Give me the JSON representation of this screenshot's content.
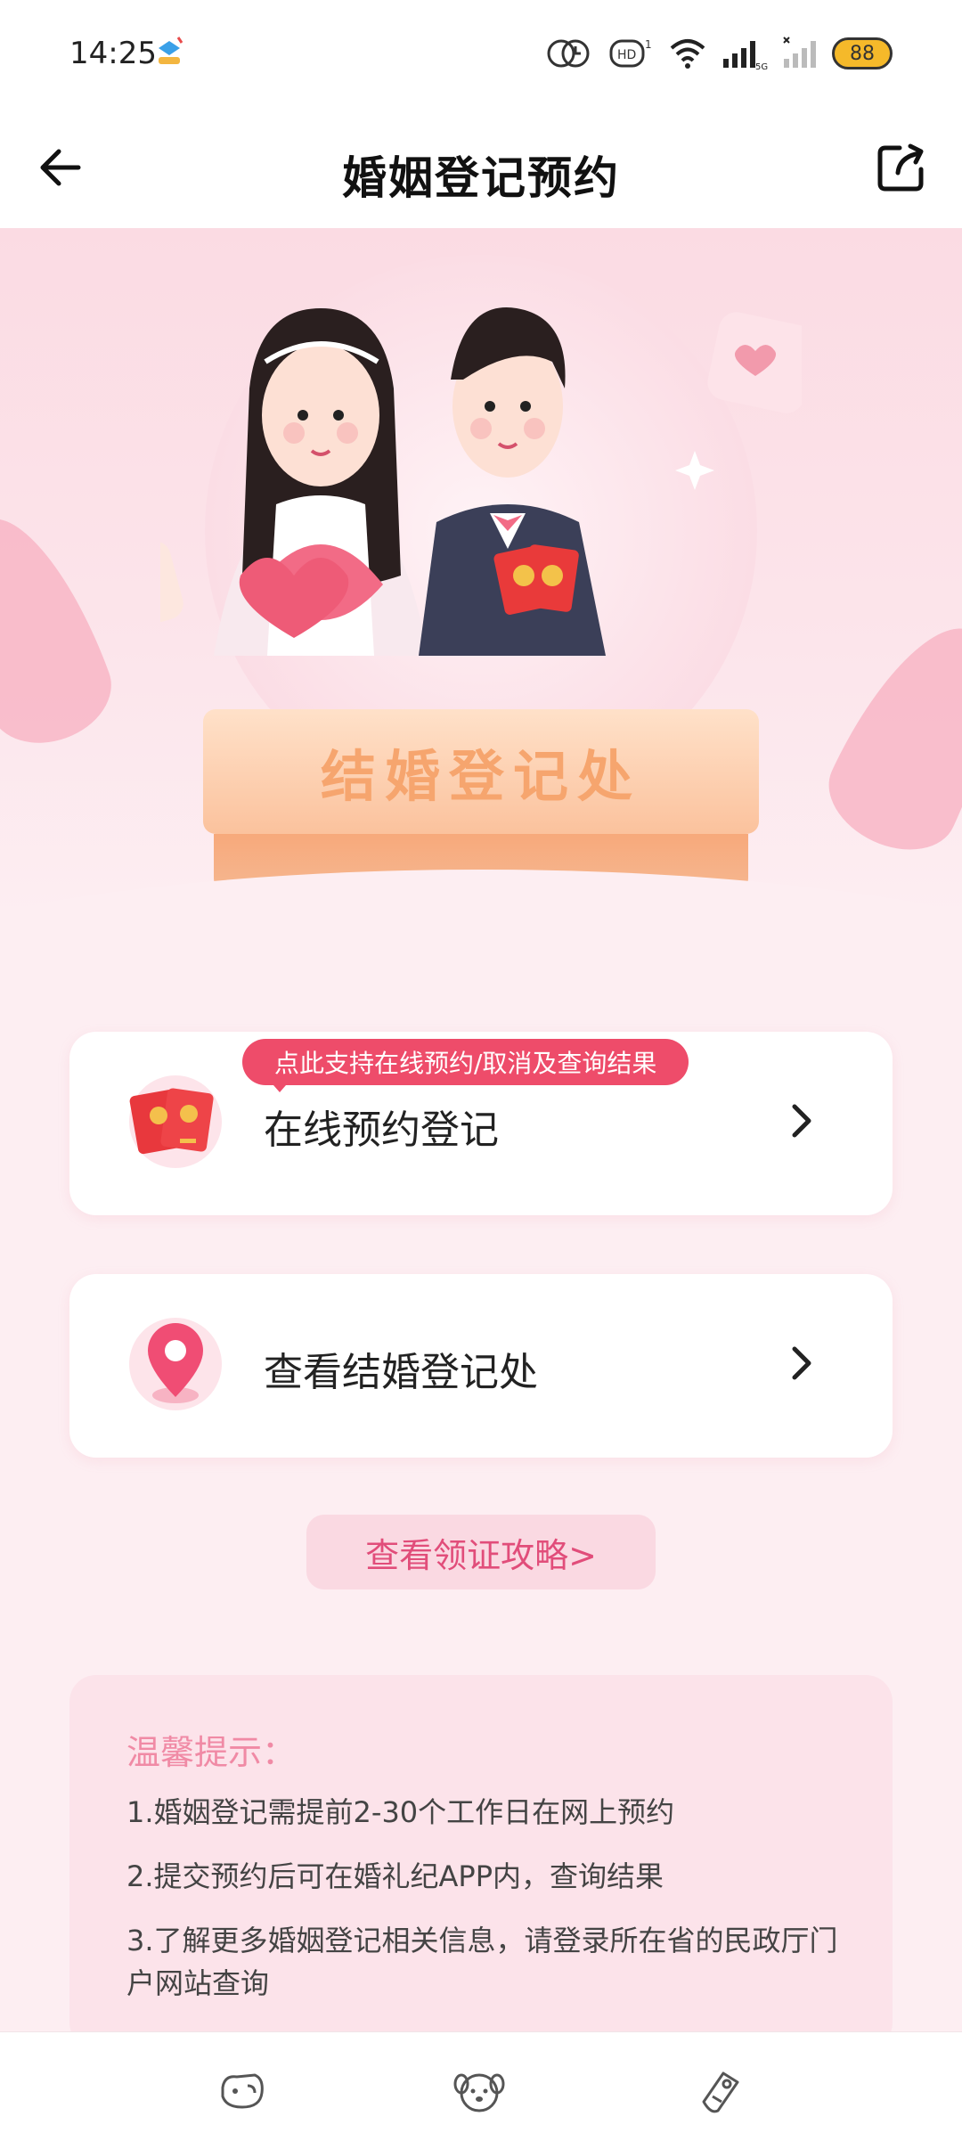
{
  "status_bar": {
    "time": "14:25",
    "network": "5G",
    "battery": "88"
  },
  "header": {
    "title": "婚姻登记预约",
    "back_icon": "arrow-left-icon",
    "share_icon": "share-icon"
  },
  "hero": {
    "sign_text": "结婚登记处"
  },
  "cards": [
    {
      "label": "在线预约登记",
      "badge": "点此支持在线预约/取消及查询结果",
      "icon": "red-envelope-icon"
    },
    {
      "label": "查看结婚登记处",
      "icon": "location-pin-icon"
    }
  ],
  "guide_link": "查看领证攻略>",
  "tips": {
    "title": "温馨提示：",
    "items": [
      "1.婚姻登记需提前2-30个工作日在网上预约",
      "2.提交预约后可在婚礼纪APP内，查询结果",
      "3.了解更多婚姻登记相关信息，请登录所在省的民政厅门户网站查询"
    ]
  },
  "colors": {
    "accent": "#ee4c6a",
    "link": "#e14d7a",
    "hero_bg": "#fbdbe3",
    "page_bg": "#fdeef2"
  }
}
